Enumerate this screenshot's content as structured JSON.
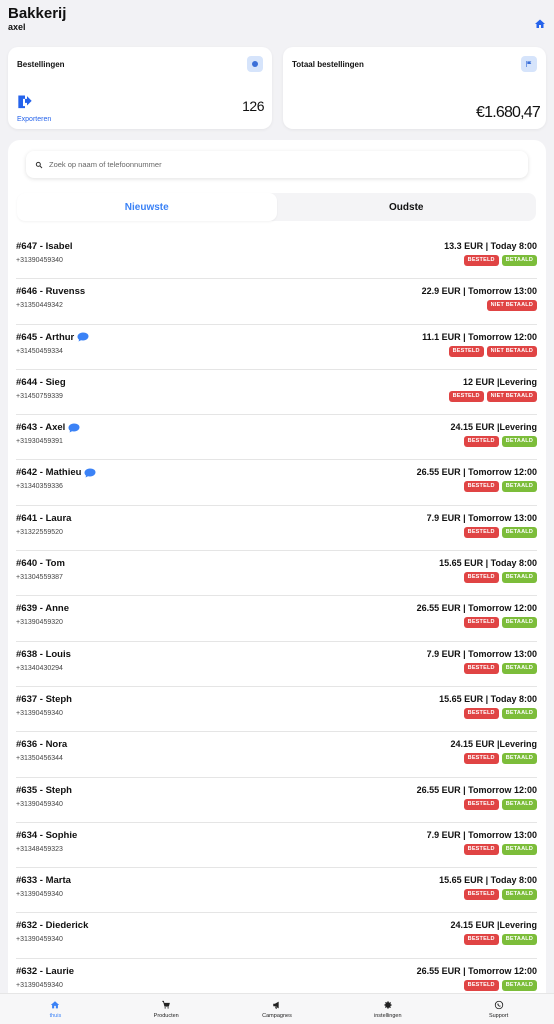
{
  "header": {
    "title": "Bakkerij",
    "subtitle": "axel"
  },
  "cards": {
    "orders": {
      "title": "Bestellingen",
      "export_label": "Exporteren",
      "count": "126"
    },
    "total": {
      "title": "Totaal bestellingen",
      "amount": "€1.680,47"
    }
  },
  "search": {
    "placeholder": "Zoek op naam of telefoonnummer"
  },
  "tabs": {
    "newest": "Nieuwste",
    "oldest": "Oudste"
  },
  "orders": [
    {
      "name": "#647 - Isabel",
      "chat": false,
      "phone": "+31390459340",
      "price": "13.3 EUR | Today 8:00",
      "badges": [
        {
          "text": "BESTELD",
          "color": "red"
        },
        {
          "text": "BETAALD",
          "color": "green"
        }
      ]
    },
    {
      "name": "#646 - Ruvenss",
      "chat": false,
      "phone": "+31350449342",
      "price": "22.9 EUR | Tomorrow 13:00",
      "badges": [
        {
          "text": "NIET BETAALD",
          "color": "red"
        }
      ]
    },
    {
      "name": "#645 - Arthur",
      "chat": true,
      "phone": "+31450459334",
      "price": "11.1 EUR | Tomorrow 12:00",
      "badges": [
        {
          "text": "BESTELD",
          "color": "red"
        },
        {
          "text": "NIET BETAALD",
          "color": "red"
        }
      ]
    },
    {
      "name": "#644 - Sieg",
      "chat": false,
      "phone": "+31450759339",
      "price": "12 EUR |Levering",
      "badges": [
        {
          "text": "BESTELD",
          "color": "red"
        },
        {
          "text": "NIET BETAALD",
          "color": "red"
        }
      ]
    },
    {
      "name": "#643 - Axel",
      "chat": true,
      "phone": "+31930459391",
      "price": "24.15 EUR |Levering",
      "badges": [
        {
          "text": "BESTELD",
          "color": "red"
        },
        {
          "text": "BETAALD",
          "color": "green"
        }
      ]
    },
    {
      "name": "#642 - Mathieu",
      "chat": true,
      "phone": "+31340359336",
      "price": "26.55 EUR | Tomorrow 12:00",
      "badges": [
        {
          "text": "BESTELD",
          "color": "red"
        },
        {
          "text": "BETAALD",
          "color": "green"
        }
      ]
    },
    {
      "name": "#641 - Laura",
      "chat": false,
      "phone": "+31322559520",
      "price": "7.9 EUR | Tomorrow 13:00",
      "badges": [
        {
          "text": "BESTELD",
          "color": "red"
        },
        {
          "text": "BETAALD",
          "color": "green"
        }
      ]
    },
    {
      "name": "#640 - Tom",
      "chat": false,
      "phone": "+31304559387",
      "price": "15.65 EUR | Today 8:00",
      "badges": [
        {
          "text": "BESTELD",
          "color": "red"
        },
        {
          "text": "BETAALD",
          "color": "green"
        }
      ]
    },
    {
      "name": "#639 - Anne",
      "chat": false,
      "phone": "+31390459320",
      "price": "26.55 EUR | Tomorrow 12:00",
      "badges": [
        {
          "text": "BESTELD",
          "color": "red"
        },
        {
          "text": "BETAALD",
          "color": "green"
        }
      ]
    },
    {
      "name": "#638 - Louis",
      "chat": false,
      "phone": "+31340430294",
      "price": "7.9 EUR | Tomorrow 13:00",
      "badges": [
        {
          "text": "BESTELD",
          "color": "red"
        },
        {
          "text": "BETAALD",
          "color": "green"
        }
      ]
    },
    {
      "name": "#637 - Steph",
      "chat": false,
      "phone": "+31390459340",
      "price": "15.65 EUR | Today 8:00",
      "badges": [
        {
          "text": "BESTELD",
          "color": "red"
        },
        {
          "text": "BETAALD",
          "color": "green"
        }
      ]
    },
    {
      "name": "#636 - Nora",
      "chat": false,
      "phone": "+31350456344",
      "price": "24.15 EUR |Levering",
      "badges": [
        {
          "text": "BESTELD",
          "color": "red"
        },
        {
          "text": "BETAALD",
          "color": "green"
        }
      ]
    },
    {
      "name": "#635 - Steph",
      "chat": false,
      "phone": "+31390459340",
      "price": "26.55 EUR | Tomorrow 12:00",
      "badges": [
        {
          "text": "BESTELD",
          "color": "red"
        },
        {
          "text": "BETAALD",
          "color": "green"
        }
      ]
    },
    {
      "name": "#634 - Sophie",
      "chat": false,
      "phone": "+31348459323",
      "price": "7.9 EUR | Tomorrow 13:00",
      "badges": [
        {
          "text": "BESTELD",
          "color": "red"
        },
        {
          "text": "BETAALD",
          "color": "green"
        }
      ]
    },
    {
      "name": "#633 - Marta",
      "chat": false,
      "phone": "+31390459340",
      "price": "15.65 EUR | Today 8:00",
      "badges": [
        {
          "text": "BESTELD",
          "color": "red"
        },
        {
          "text": "BETAALD",
          "color": "green"
        }
      ]
    },
    {
      "name": "#632 - Diederick",
      "chat": false,
      "phone": "+31390459340",
      "price": "24.15 EUR |Levering",
      "badges": [
        {
          "text": "BESTELD",
          "color": "red"
        },
        {
          "text": "BETAALD",
          "color": "green"
        }
      ]
    },
    {
      "name": "#632 - Laurie",
      "chat": false,
      "phone": "+31390459340",
      "price": "26.55 EUR | Tomorrow 12:00",
      "badges": [
        {
          "text": "BESTELD",
          "color": "red"
        },
        {
          "text": "BETAALD",
          "color": "green"
        }
      ]
    }
  ],
  "nav": [
    {
      "label": "thuis",
      "icon": "home-icon",
      "active": true
    },
    {
      "label": "Producten",
      "icon": "products-icon",
      "active": false
    },
    {
      "label": "Campagnes",
      "icon": "megaphone-icon",
      "active": false
    },
    {
      "label": "instellingen",
      "icon": "gear-icon",
      "active": false
    },
    {
      "label": "Support",
      "icon": "whatsapp-icon",
      "active": false
    }
  ],
  "colors": {
    "accent": "#3b82f6",
    "red_badge": "#e04444",
    "green_badge": "#7cbd3a"
  }
}
